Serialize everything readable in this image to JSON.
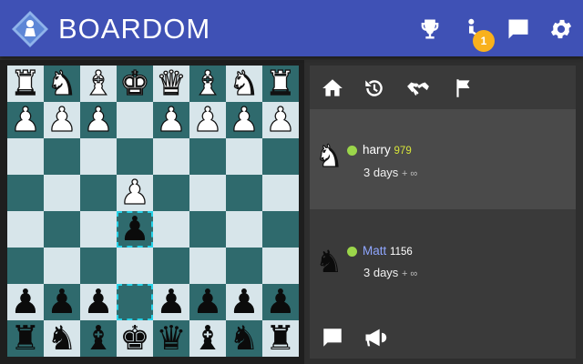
{
  "app": {
    "name": "BOARDOM",
    "colors": {
      "header": "#3f51b5",
      "badge": "#f9b11c",
      "online": "#9bd64a",
      "light_square": "#d7e5ea",
      "dark_square": "#2f6a6d",
      "highlight": "#25d2e8"
    }
  },
  "header": {
    "notification_count": "1",
    "icons": [
      "trophy-icon",
      "user-icon",
      "chat-icon",
      "gear-icon"
    ]
  },
  "board": {
    "highlighted_squares": [
      "d4",
      "d2"
    ],
    "pieces": [
      {
        "sq": "a8",
        "color": "w",
        "glyph": "♜",
        "kind": "rook"
      },
      {
        "sq": "b8",
        "color": "w",
        "glyph": "♞",
        "kind": "knight"
      },
      {
        "sq": "c8",
        "color": "w",
        "glyph": "♝",
        "kind": "bishop"
      },
      {
        "sq": "d8",
        "color": "w",
        "glyph": "♚",
        "kind": "king"
      },
      {
        "sq": "e8",
        "color": "w",
        "glyph": "♛",
        "kind": "queen"
      },
      {
        "sq": "f8",
        "color": "w",
        "glyph": "♝",
        "kind": "bishop"
      },
      {
        "sq": "g8",
        "color": "w",
        "glyph": "♞",
        "kind": "knight"
      },
      {
        "sq": "h8",
        "color": "w",
        "glyph": "♜",
        "kind": "rook"
      },
      {
        "sq": "a7",
        "color": "w",
        "glyph": "♟",
        "kind": "pawn"
      },
      {
        "sq": "b7",
        "color": "w",
        "glyph": "♟",
        "kind": "pawn"
      },
      {
        "sq": "c7",
        "color": "w",
        "glyph": "♟",
        "kind": "pawn"
      },
      {
        "sq": "e7",
        "color": "w",
        "glyph": "♟",
        "kind": "pawn"
      },
      {
        "sq": "f7",
        "color": "w",
        "glyph": "♟",
        "kind": "pawn"
      },
      {
        "sq": "g7",
        "color": "w",
        "glyph": "♟",
        "kind": "pawn"
      },
      {
        "sq": "h7",
        "color": "w",
        "glyph": "♟",
        "kind": "pawn"
      },
      {
        "sq": "d5",
        "color": "w",
        "glyph": "♟",
        "kind": "pawn"
      },
      {
        "sq": "d4",
        "color": "b",
        "glyph": "♟",
        "kind": "pawn"
      },
      {
        "sq": "a2",
        "color": "b",
        "glyph": "♟",
        "kind": "pawn"
      },
      {
        "sq": "b2",
        "color": "b",
        "glyph": "♟",
        "kind": "pawn"
      },
      {
        "sq": "c2",
        "color": "b",
        "glyph": "♟",
        "kind": "pawn"
      },
      {
        "sq": "e2",
        "color": "b",
        "glyph": "♟",
        "kind": "pawn"
      },
      {
        "sq": "f2",
        "color": "b",
        "glyph": "♟",
        "kind": "pawn"
      },
      {
        "sq": "g2",
        "color": "b",
        "glyph": "♟",
        "kind": "pawn"
      },
      {
        "sq": "h2",
        "color": "b",
        "glyph": "♟",
        "kind": "pawn"
      },
      {
        "sq": "a1",
        "color": "b",
        "glyph": "♜",
        "kind": "rook"
      },
      {
        "sq": "b1",
        "color": "b",
        "glyph": "♞",
        "kind": "knight"
      },
      {
        "sq": "c1",
        "color": "b",
        "glyph": "♝",
        "kind": "bishop"
      },
      {
        "sq": "d1",
        "color": "b",
        "glyph": "♚",
        "kind": "king"
      },
      {
        "sq": "e1",
        "color": "b",
        "glyph": "♛",
        "kind": "queen"
      },
      {
        "sq": "f1",
        "color": "b",
        "glyph": "♝",
        "kind": "bishop"
      },
      {
        "sq": "g1",
        "color": "b",
        "glyph": "♞",
        "kind": "knight"
      },
      {
        "sq": "h1",
        "color": "b",
        "glyph": "♜",
        "kind": "rook"
      }
    ]
  },
  "panel": {
    "tabs": [
      "home-icon",
      "history-icon",
      "handshake-icon",
      "flag-icon"
    ],
    "players": [
      {
        "name": "harry",
        "rating": "979",
        "time": "3 days",
        "increment": "+ ∞",
        "name_color": "#ffffff",
        "rating_color": "#d7e43a",
        "online": true
      },
      {
        "name": "Matt",
        "rating": "1156",
        "time": "3 days",
        "increment": "+ ∞",
        "name_color": "#8fa6ff",
        "rating_color": "#ffffff",
        "online": true
      }
    ],
    "bottom_icons": [
      "chat-icon",
      "megaphone-icon"
    ]
  }
}
